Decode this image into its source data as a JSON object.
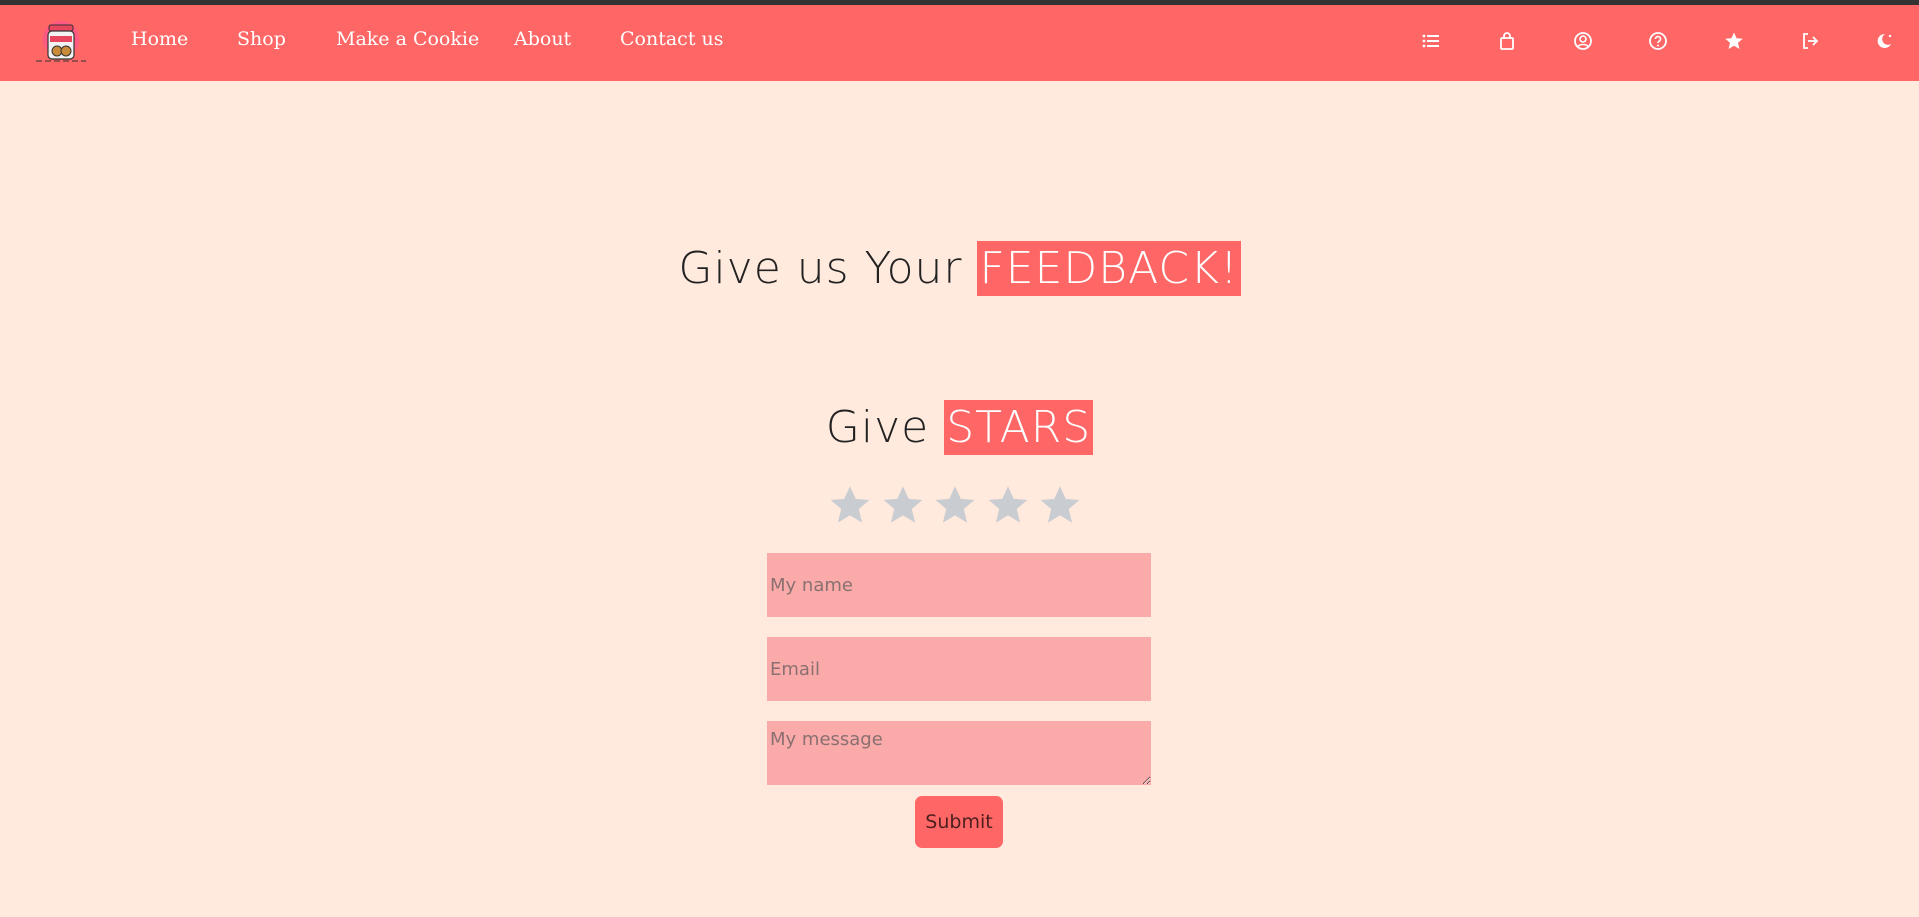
{
  "nav": {
    "links": [
      "Home",
      "Shop",
      "Make a Cookie",
      "About",
      "Contact us"
    ],
    "icons": [
      "list-icon",
      "shopping-bag-icon",
      "user-circle-icon",
      "help-circle-icon",
      "star-icon",
      "logout-icon",
      "theme-toggle-icon"
    ]
  },
  "feedback": {
    "heading_prefix": "Give us Your ",
    "heading_highlight": "FEEDBACK!",
    "stars_prefix": "Give ",
    "stars_highlight": "STARS",
    "rating": 0,
    "max_rating": 5
  },
  "form": {
    "name_placeholder": "My name",
    "email_placeholder": "Email",
    "message_placeholder": "My message",
    "submit_label": "Submit"
  },
  "colors": {
    "navbar": "#ff6666",
    "page_bg": "#ffeadd",
    "input_bg": "#fbaaaa",
    "star_inactive": "#c9ccd1",
    "highlight": "#ff6666"
  }
}
